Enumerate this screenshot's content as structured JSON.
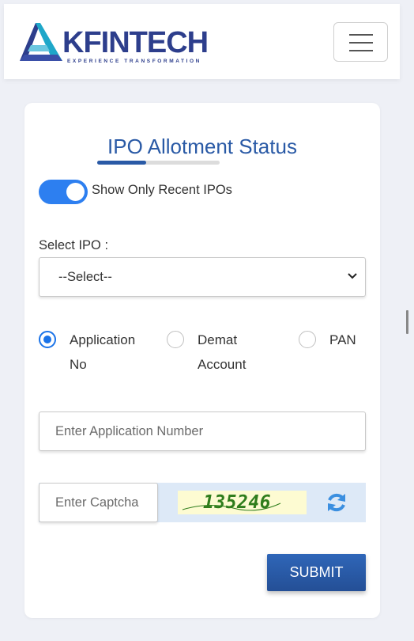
{
  "header": {
    "brand_name": "KFINTECH",
    "brand_tagline": "EXPERIENCE TRANSFORMATION",
    "menu_icon": "hamburger-menu-icon"
  },
  "form": {
    "title": "IPO Allotment Status",
    "recent_toggle": {
      "label": "Show Only Recent IPOs",
      "checked": true
    },
    "select_label": "Select IPO :",
    "select_value": "--Select--",
    "radio_options": [
      {
        "line1": "Application",
        "line2": "No",
        "checked": true
      },
      {
        "line1": "Demat",
        "line2": "Account",
        "checked": false
      },
      {
        "line1": "PAN",
        "line2": "",
        "checked": false
      }
    ],
    "application_placeholder": "Enter Application Number",
    "captcha_placeholder": "Enter Captcha",
    "captcha_code": "135246",
    "refresh_icon": "refresh-icon",
    "submit_label": "SUBMIT"
  },
  "colors": {
    "primary": "#2a5aa6",
    "toggle_on": "#2d7ff0",
    "radio_checked": "#1a73e8",
    "captcha_text": "#2f7d1c",
    "captcha_bg": "#fdfbd2",
    "page_bg": "#eef0f6"
  }
}
